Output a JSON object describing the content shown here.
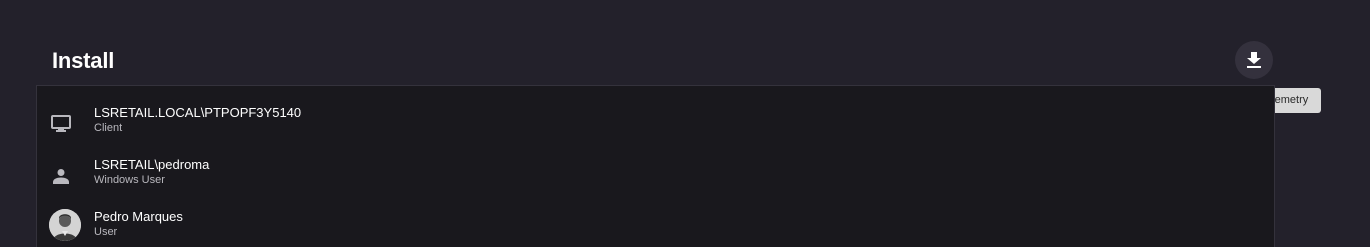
{
  "header": {
    "title": "Install",
    "export_button_icon": "download-icon",
    "export_tooltip": "Export install telemetry"
  },
  "items": [
    {
      "icon": "monitor-icon",
      "primary": "LSRETAIL.LOCAL\\PTPOPF3Y5140",
      "secondary": "Client"
    },
    {
      "icon": "person-icon",
      "primary": "LSRETAIL\\pedroma",
      "secondary": "Windows User"
    },
    {
      "icon": "avatar",
      "primary": "Pedro Marques",
      "secondary": "User"
    }
  ],
  "colors": {
    "background": "#23212b",
    "panel": "#19181d",
    "tooltip_bg": "#d9d9d9",
    "icon": "#b9b8be"
  }
}
